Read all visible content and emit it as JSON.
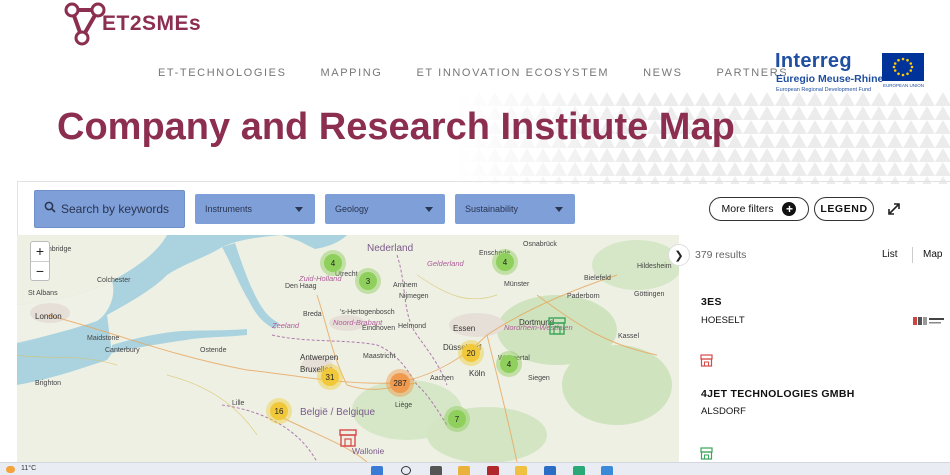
{
  "brand": {
    "logo_text": "ET2SMEs"
  },
  "nav": [
    "ET-TECHNOLOGIES",
    "MAPPING",
    "ET INNOVATION ECOSYSTEM",
    "NEWS",
    "PARTNERS"
  ],
  "interreg": {
    "word": "Interreg",
    "subtitle": "Euregio Meuse-Rhine",
    "fund": "European Regional Development Fund",
    "eu": "EUROPEAN UNION"
  },
  "page_title": "Company and Research Institute Map",
  "filters": {
    "search_placeholder": "Search by keywords",
    "dropdowns": [
      "Instruments",
      "Geology",
      "Sustainability"
    ],
    "more_filters": "More filters",
    "legend": "LEGEND"
  },
  "map": {
    "zoom_in": "+",
    "zoom_out": "−",
    "cities": [
      "Cambridge",
      "Colchester",
      "St Albans",
      "London",
      "Maidstone",
      "Canterbury",
      "Brighton",
      "Lille",
      "Ostende",
      "Antwerpen",
      "Bruxelles",
      "Maastricht",
      "Liège",
      "Aachen",
      "Köln",
      "Düsseldorf",
      "Essen",
      "Dortmund",
      "Münster",
      "Bielefeld",
      "Paderborn",
      "Osnabrück",
      "Hildesheim",
      "Kassel",
      "Siegen",
      "Arnhem",
      "Nijmegen",
      "Helmond",
      "Eindhoven",
      "Utrecht",
      "Den Haag",
      "'s-Hertogenbosch",
      "Breda",
      "Enschede",
      "Wuppertal",
      "Göttingen"
    ],
    "regions": [
      "Zuid-Holland",
      "Zeeland",
      "Noord-Brabant",
      "Gelderland",
      "Nordrhein-Westfalen"
    ],
    "countries": [
      "Nederland",
      "België / Belgique",
      "Wallonie"
    ],
    "clusters": [
      "4",
      "3",
      "4",
      "20",
      "4",
      "31",
      "287",
      "16",
      "7"
    ]
  },
  "results": {
    "count": "379 results",
    "view_list": "List",
    "view_map": "Map",
    "items": [
      {
        "name": "3ES",
        "city": "HOESELT"
      },
      {
        "name": "4JET TECHNOLOGIES GMBH",
        "city": "ALSDORF"
      }
    ]
  },
  "taskbar": {
    "temperature": "11°C"
  },
  "colors": {
    "brand": "#8c2e4f",
    "filter_blue": "#7e9fd8",
    "interreg_blue": "#1f4fa0"
  }
}
